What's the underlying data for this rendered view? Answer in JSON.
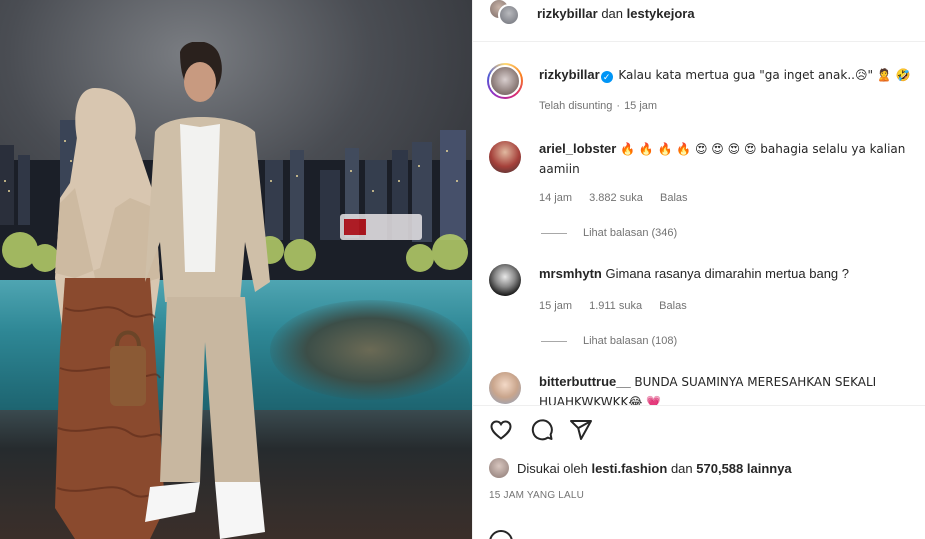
{
  "header": {
    "user1": "rizkybillar",
    "connector": "dan",
    "user2": "lestykejora"
  },
  "caption": {
    "username": "rizkybillar",
    "text": "Kalau kata mertua gua \"ga inget anak..😥\" 🙎 🤣",
    "edited": "Telah disunting",
    "time": "15 jam"
  },
  "comments": [
    {
      "username": "ariel_lobster",
      "text": "🔥 🔥 🔥 🔥 😍 😍 😍 😍 bahagia selalu ya kalian aamiin",
      "time": "14 jam",
      "likes": "3.882 suka",
      "reply": "Balas",
      "view_replies": "Lihat balasan (346)"
    },
    {
      "username": "mrsmhytn",
      "text": "Gimana rasanya dimarahin mertua bang ?",
      "time": "15 jam",
      "likes": "1.911 suka",
      "reply": "Balas",
      "view_replies": "Lihat balasan (108)"
    },
    {
      "username": "bitterbuttrue__",
      "text": "BUNDA SUAMINYA MERESAHKAN SEKALI HUAHKWKWKK😂 💗"
    }
  ],
  "likes_line": {
    "prefix": "Disukai oleh",
    "user": "lesti.fashion",
    "connector": "dan",
    "count": "570,588 lainnya"
  },
  "timestamp": "15 JAM YANG LALU",
  "photo_sign": "UOB",
  "icons": [
    "heart-icon",
    "comment-icon",
    "share-icon",
    "verified-badge-icon"
  ]
}
